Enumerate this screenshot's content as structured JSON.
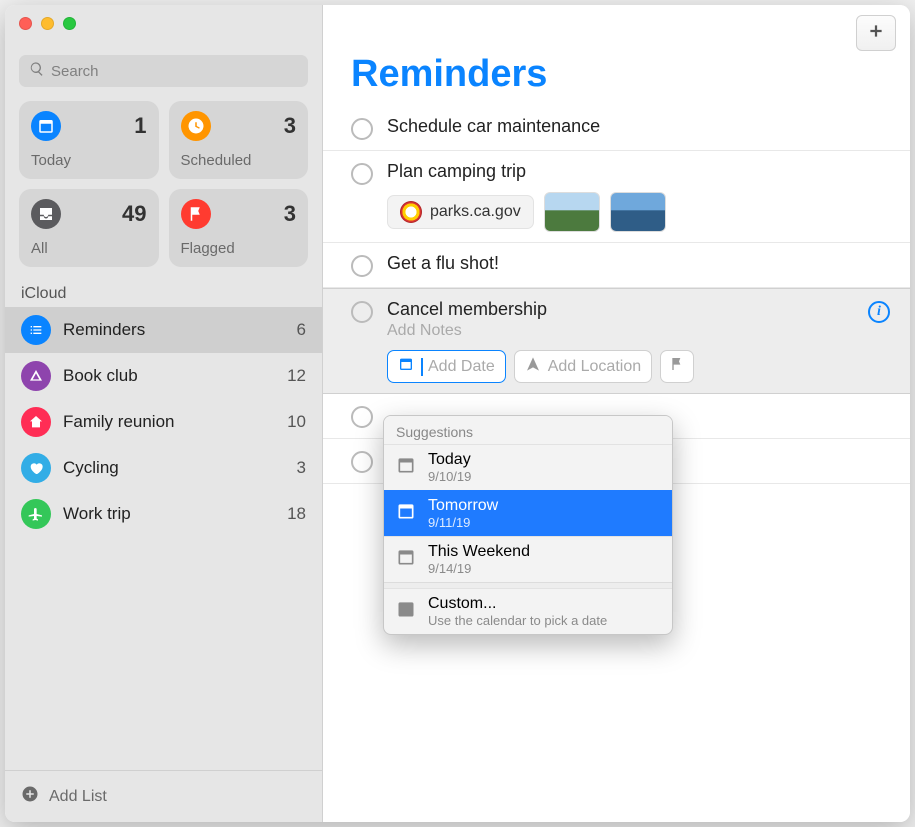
{
  "search": {
    "placeholder": "Search"
  },
  "smart": [
    {
      "label": "Today",
      "count": "1",
      "icon": "calendar-icon",
      "color": "i-blue"
    },
    {
      "label": "Scheduled",
      "count": "3",
      "icon": "clock-icon",
      "color": "i-orange"
    },
    {
      "label": "All",
      "count": "49",
      "icon": "tray-icon",
      "color": "i-gray"
    },
    {
      "label": "Flagged",
      "count": "3",
      "icon": "flag-icon",
      "color": "i-red"
    }
  ],
  "section_label": "iCloud",
  "lists": [
    {
      "name": "Reminders",
      "count": "6",
      "color": "c-blue",
      "icon": "list-icon",
      "selected": true
    },
    {
      "name": "Book club",
      "count": "12",
      "color": "c-purple",
      "icon": "tent-icon",
      "selected": false
    },
    {
      "name": "Family reunion",
      "count": "10",
      "color": "c-pink",
      "icon": "house-icon",
      "selected": false
    },
    {
      "name": "Cycling",
      "count": "3",
      "color": "c-teal",
      "icon": "heart-icon",
      "selected": false
    },
    {
      "name": "Work trip",
      "count": "18",
      "color": "c-green",
      "icon": "plane-icon",
      "selected": false
    }
  ],
  "add_list_label": "Add List",
  "main": {
    "title": "Reminders",
    "reminders": [
      {
        "title": "Schedule car maintenance"
      },
      {
        "title": "Plan camping trip",
        "link": "parks.ca.gov",
        "has_attachments": true
      },
      {
        "title": "Get a flu shot!"
      },
      {
        "title": "Cancel membership",
        "editing": true,
        "notes_placeholder": "Add Notes",
        "chips": {
          "date": "Add Date",
          "location": "Add Location"
        }
      }
    ]
  },
  "suggestions": {
    "header": "Suggestions",
    "items": [
      {
        "title": "Today",
        "sub": "9/10/19",
        "selected": false
      },
      {
        "title": "Tomorrow",
        "sub": "9/11/19",
        "selected": true
      },
      {
        "title": "This Weekend",
        "sub": "9/14/19",
        "selected": false
      }
    ],
    "custom": {
      "title": "Custom...",
      "sub": "Use the calendar to pick a date"
    }
  }
}
